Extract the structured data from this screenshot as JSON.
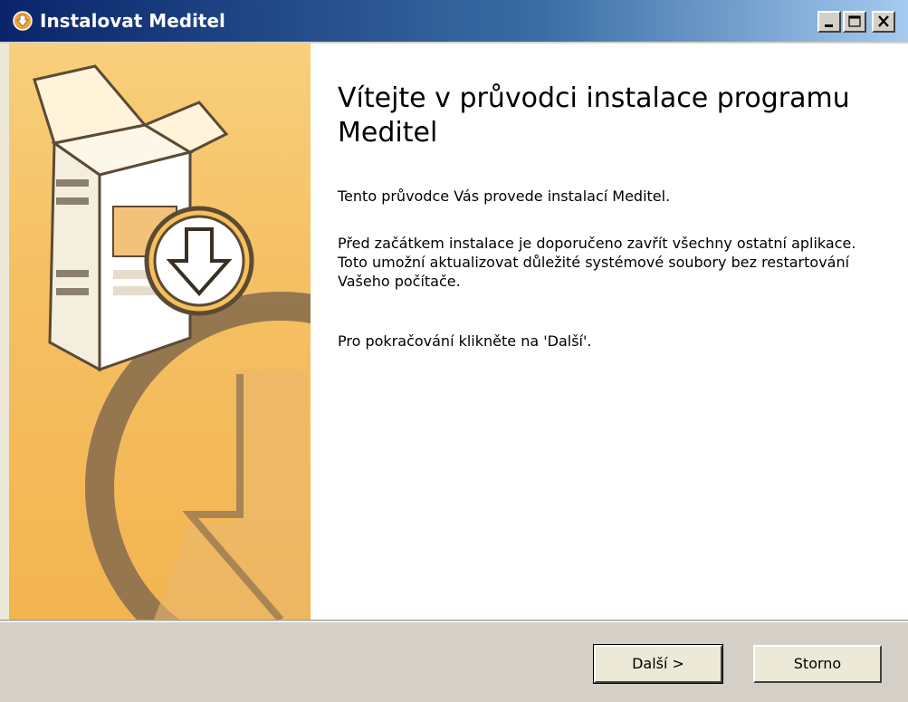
{
  "window": {
    "title": "Instalovat Meditel",
    "title_icon": "installer-icon",
    "controls": {
      "minimize": "minimize-icon",
      "maximize": "maximize-icon",
      "close": "close-icon"
    }
  },
  "banner": {
    "image": "installer-box-download-illustration",
    "colors": {
      "background": "#f5c064",
      "ring": "#8b6f4e"
    }
  },
  "content": {
    "heading": "Vítejte v průvodci instalace programu Meditel",
    "paragraphs": [
      "Tento průvodce Vás provede instalací Meditel.",
      "Před začátkem instalace je doporučeno zavřít všechny ostatní aplikace. Toto umožní aktualizovat důležité systémové soubory bez restartování Vašeho počítače.",
      "Pro pokračování klikněte na 'Další'."
    ]
  },
  "footer": {
    "next_label": "Další >",
    "cancel_label": "Storno"
  },
  "colors": {
    "titlebar_start": "#0a246a",
    "titlebar_end": "#a6caf0",
    "footer_bg": "#d4d0c8"
  }
}
